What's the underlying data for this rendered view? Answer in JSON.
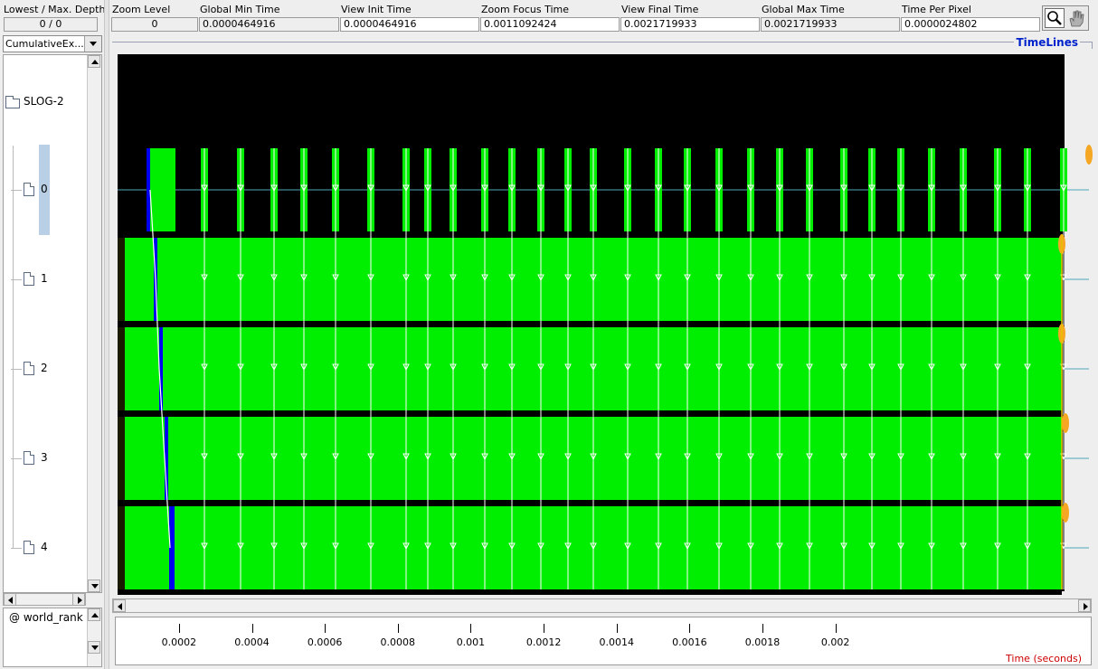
{
  "left_panel": {
    "depth_label": "Lowest / Max. Depth",
    "depth_value": "0 / 0",
    "view_combo": "CumulativeEx...",
    "tree": {
      "root": "SLOG-2",
      "nodes": [
        {
          "label": "0"
        },
        {
          "label": "1"
        },
        {
          "label": "2"
        },
        {
          "label": "3"
        },
        {
          "label": "4"
        }
      ],
      "selected_index": 0
    },
    "group_label": "@ world_rank"
  },
  "toolbar": {
    "zoom_level": {
      "label": "Zoom Level",
      "value": "0"
    },
    "global_min_time": {
      "label": "Global Min Time",
      "value": "0.0000464916"
    },
    "view_init_time": {
      "label": "View  Init Time",
      "value": "0.0000464916"
    },
    "zoom_focus_time": {
      "label": "Zoom Focus Time",
      "value": "0.0011092424"
    },
    "view_final_time": {
      "label": "View Final Time",
      "value": "0.0021719933"
    },
    "global_max_time": {
      "label": "Global Max Time",
      "value": "0.0021719933"
    },
    "time_per_pixel": {
      "label": "Time Per Pixel",
      "value": "0.0000024802"
    },
    "tools": [
      "magnifier-icon",
      "hand-icon"
    ]
  },
  "timelines": {
    "title": "TimeLines",
    "background": "#000000",
    "state_color": "#00ee00",
    "message_color": "#ffffff",
    "marker_color": "#f5a623",
    "row_count": 5
  },
  "time_axis": {
    "ticks": [
      "0.0002",
      "0.0004",
      "0.0006",
      "0.0008",
      "0.001",
      "0.0012",
      "0.0014",
      "0.0016",
      "0.0018",
      "0.002"
    ],
    "tick_values": [
      0.0002,
      0.0004,
      0.0006,
      0.0008,
      0.001,
      0.0012,
      0.0014,
      0.0016,
      0.0018,
      0.002
    ],
    "unit_label": "Time (seconds)"
  }
}
